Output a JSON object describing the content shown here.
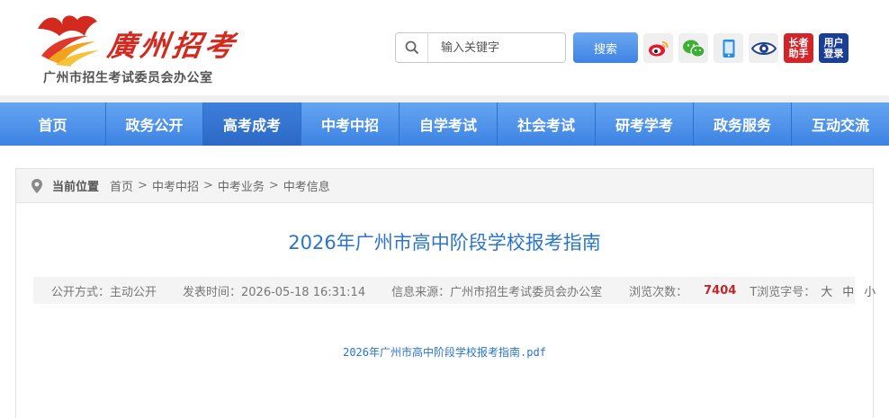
{
  "header": {
    "logo_script": "廣州招考",
    "logo_subtitle": "广州市招生考试委员会办公室",
    "search_placeholder": "输入关键字",
    "search_button": "搜索",
    "tools": [
      {
        "icon": "weibo-icon"
      },
      {
        "icon": "wechat-icon"
      },
      {
        "icon": "mobile-icon"
      },
      {
        "icon": "eye-icon"
      },
      {
        "icon": "elder-assistant-icon",
        "label_top": "长者",
        "label_bottom": "助手"
      },
      {
        "icon": "user-login-icon",
        "label_top": "用户",
        "label_bottom": "登录"
      }
    ]
  },
  "nav": {
    "items": [
      "首页",
      "政务公开",
      "高考成考",
      "中考中招",
      "自学考试",
      "社会考试",
      "研考学考",
      "政务服务",
      "互动交流"
    ],
    "active_index": 2
  },
  "breadcrumb": {
    "label": "当前位置",
    "items": [
      "首页",
      "中考中招",
      "中考业务",
      "中考信息"
    ],
    "separator": ">"
  },
  "article": {
    "title": "2026年广州市高中阶段学校报考指南",
    "meta": {
      "publish_mode": "公开方式：主动公开",
      "publish_time": "发表时间：2026-05-18 16:31:14",
      "source": "信息来源：广州市招生考试委员会办公室",
      "views_label": "浏览次数：",
      "views": "7404",
      "font_size_label": "T浏览字号：",
      "font_sizes": [
        "大",
        "中",
        "小"
      ]
    },
    "attachment": "2026年广州市高中阶段学校报考指南.pdf"
  },
  "colors": {
    "nav_blue": "#3d83e3",
    "title_blue": "#2a74cc",
    "logo_red": "#d22a1f",
    "views_red": "#c0262c"
  }
}
